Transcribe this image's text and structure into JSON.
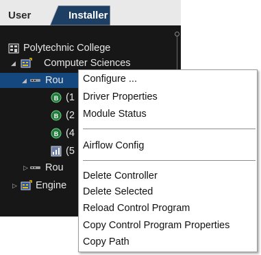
{
  "tabs": {
    "user": "User",
    "installer": "Installer"
  },
  "tree": {
    "college": "Polytechnic College",
    "dept": "Computer Sciences",
    "router_partial": "Rou",
    "child1": "(1",
    "child2": "(2",
    "child3": "(4",
    "child4": "(5",
    "router2_partial": "Rou",
    "engineering_partial": "Engine"
  },
  "menu": {
    "group1": [
      "Configure ...",
      "Driver Properties",
      "Module Status"
    ],
    "group2": [
      "Airflow Config"
    ],
    "group3": [
      "Delete Controller",
      "Delete Selected",
      "Reload Control Program",
      "Copy Control Program Properties",
      "Copy Path"
    ]
  },
  "colors": {
    "pane_bg": "#171717",
    "selection": "#15487e",
    "tab_active": "#1c3f63",
    "badge_green": "#1f7a3a"
  }
}
